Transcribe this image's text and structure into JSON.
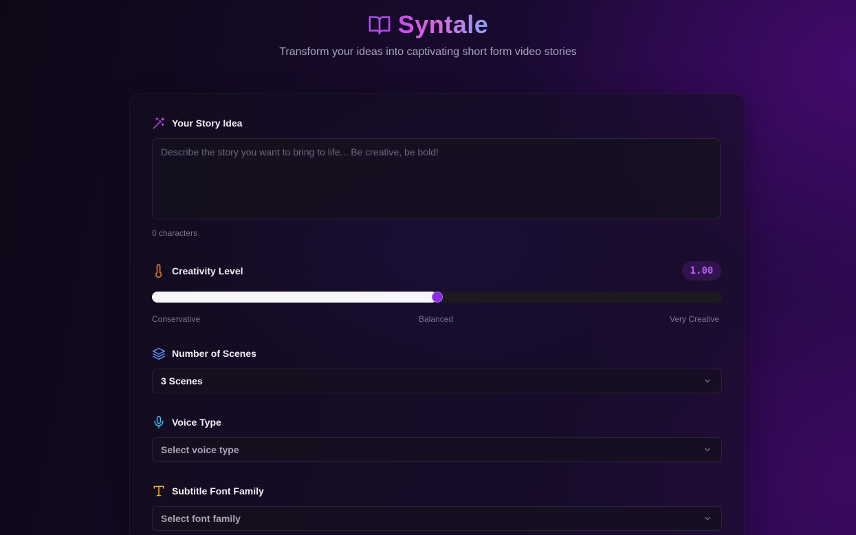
{
  "app": {
    "title": "Syntale",
    "tagline": "Transform your ideas into captivating short form video stories"
  },
  "story": {
    "label": "Your Story Idea",
    "value": "",
    "placeholder": "Describe the story you want to bring to life... Be creative, be bold!",
    "char_count": "0 characters"
  },
  "creativity": {
    "label": "Creativity Level",
    "value_text": "1.00",
    "value": 1.0,
    "min": 0,
    "max": 2,
    "scale_labels": {
      "left": "Conservative",
      "middle": "Balanced",
      "right": "Very Creative"
    }
  },
  "scenes": {
    "label": "Number of Scenes",
    "selected": "3 Scenes"
  },
  "voice": {
    "label": "Voice Type",
    "placeholder": "Select voice type"
  },
  "font": {
    "label": "Subtitle Font Family",
    "placeholder": "Select font family"
  },
  "icons": {
    "brand": "book-open-icon",
    "story": "magic-wand-icon",
    "creativity": "thermometer-icon",
    "scenes": "layers-icon",
    "voice": "microphone-icon",
    "font": "type-icon",
    "dropdown": "chevron-down-icon"
  },
  "colors": {
    "accent_purple": "#8a2be2",
    "brand_gradient_start": "#c84bf0",
    "brand_gradient_end": "#8aa2f5",
    "creativity_icon": "#f08a24",
    "scenes_icon": "#5b8df5",
    "voice_icon": "#38bdf8",
    "font_icon": "#f0b323"
  }
}
